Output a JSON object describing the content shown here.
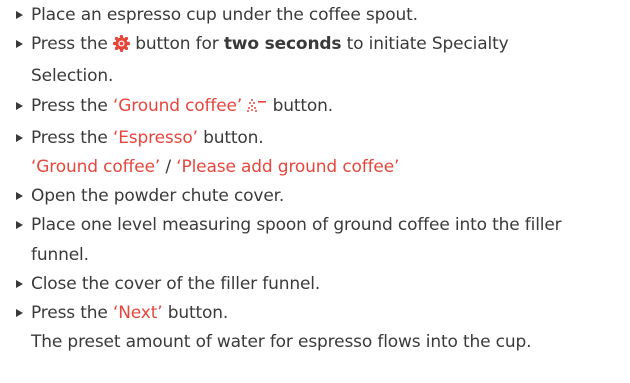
{
  "steps": [
    {
      "text": "Place an espresso cup under the coffee spout."
    },
    {
      "pre": "Press the ",
      "icon": "specialty-gear-icon",
      "mid": " button for ",
      "bold": "two seconds",
      "post": " to initiate Specialty",
      "cont": "Selection."
    },
    {
      "pre": "Press the ",
      "red": "‘Ground coffee’",
      "icon": "ground-coffee-icon",
      "post": " button."
    },
    {
      "pre": "Press the ",
      "red": "‘Espresso’",
      "post": " button."
    },
    {
      "text": "Open the powder chute cover."
    },
    {
      "text": "Place one level measuring spoon of ground coffee into the filler",
      "cont": "funnel."
    },
    {
      "text": "Close the cover of the filler funnel."
    },
    {
      "pre": "Press the ",
      "red": "‘Next’",
      "post": " button."
    }
  ],
  "espresso_display": {
    "left": "‘Ground coffee’",
    "separator": " / ",
    "right": "‘Please add ground coffee’"
  },
  "result_text": "The preset amount of water for espresso flows into the cup.",
  "colors": {
    "text": "#3a3a3a",
    "accent": "#e5473d"
  }
}
